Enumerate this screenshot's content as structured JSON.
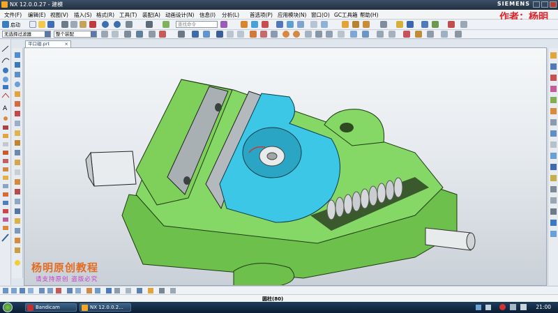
{
  "window": {
    "title": "NX 12.0.0.27 - 建模",
    "brand": "SIEMENS",
    "author": "作者：杨明"
  },
  "menu": [
    "文件(F)",
    "编辑(E)",
    "视图(V)",
    "插入(S)",
    "格式(R)",
    "工具(T)",
    "装配(A)",
    "动画设计(N)",
    "信息(I)",
    "分析(L)",
    "首选项(P)",
    "应用模块(N)",
    "窗口(O)",
    "GC工具箱",
    "帮助(H)"
  ],
  "toolbar": {
    "start_label": "启动",
    "search_placeholder": "查找命令",
    "filter_select": "无选择过滤器",
    "assembly_select": "整个装配"
  },
  "tab": {
    "label": "平口钳.prt",
    "close": "×"
  },
  "watermark": {
    "title": "杨明原创教程",
    "subtitle": "请支持原创 盗版必究"
  },
  "status": {
    "text": "圆柱(80)"
  },
  "taskbar": {
    "items": [
      "Bandicam",
      "NX 12.0.0.2..."
    ],
    "time": "21:00"
  },
  "colors": {
    "body_green": "#7ed35f",
    "jaw_cyan": "#3cc7e6",
    "spring": "#c9cdcf",
    "author_red": "#e0242a",
    "watermark_orange": "#e36c22",
    "watermark_purple": "#c640c4"
  }
}
